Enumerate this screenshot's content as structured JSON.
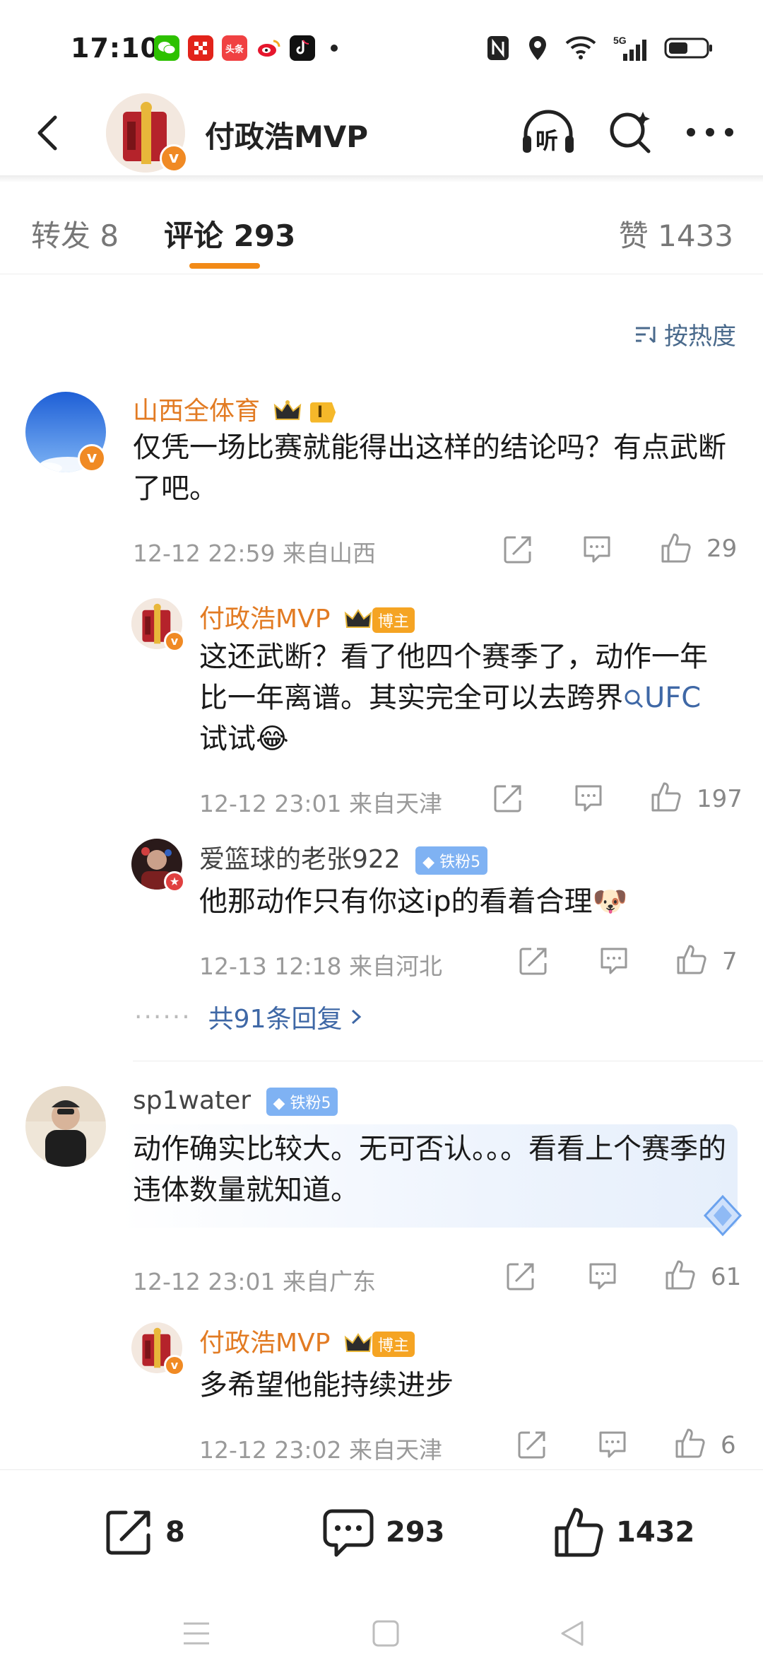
{
  "status_bar": {
    "time": "17:10",
    "notification_icons": [
      "wechat-icon",
      "app-icon",
      "toutiao-icon",
      "weibo-icon",
      "douyin-icon"
    ],
    "toutiao_label": "头条",
    "system_icons": [
      "nfc-icon",
      "location-icon",
      "wifi-icon",
      "signal-5g-icon",
      "battery-icon"
    ],
    "network": "5G"
  },
  "header": {
    "title": "付政浩MVP",
    "listen_label": "听"
  },
  "tabs": {
    "repost": "转发 8",
    "comment": "评论 293",
    "like": "赞 1433"
  },
  "sort_label": "按热度",
  "comments": [
    {
      "user": "山西全体育",
      "level_badge": "I",
      "text": "仅凭一场比赛就能得出这样的结论吗？有点武断了吧。",
      "meta": "12-12 22:59  来自山西",
      "likes": "29",
      "replies": [
        {
          "user": "付政浩MVP",
          "tag": "博主",
          "text_before": "这还武断？看了他四个赛季了，动作一年比一年离谱。其实完全可以去跨界",
          "link": "UFC",
          "text_after": " 试试",
          "emoji": "😂",
          "meta": "12-12 23:01  来自天津",
          "likes": "197"
        },
        {
          "user": "爱篮球的老张922",
          "tag": "铁粉5",
          "text": "他那动作只有你这ip的看着合理",
          "emoji": "🐶",
          "meta": "12-13 12:18  来自河北",
          "likes": "7"
        }
      ],
      "more_replies": "共91条回复"
    },
    {
      "user": "sp1water",
      "tag": "铁粉5",
      "text": "动作确实比较大。无可否认。。。看看上个赛季的违体数量就知道。",
      "meta": "12-12 23:01  来自广东",
      "likes": "61",
      "replies": [
        {
          "user": "付政浩MVP",
          "tag": "博主",
          "text": "多希望他能持续进步",
          "meta": "12-12 23:02  来自天津",
          "likes": "6"
        }
      ]
    }
  ],
  "bottom_bar": {
    "share_count": "8",
    "comment_count": "293",
    "like_count": "1432"
  },
  "colors": {
    "accent_orange": "#f28a17",
    "username_orange": "#e27b23",
    "link_blue": "#3f68a6",
    "meta_gray": "#9a9a9a"
  }
}
